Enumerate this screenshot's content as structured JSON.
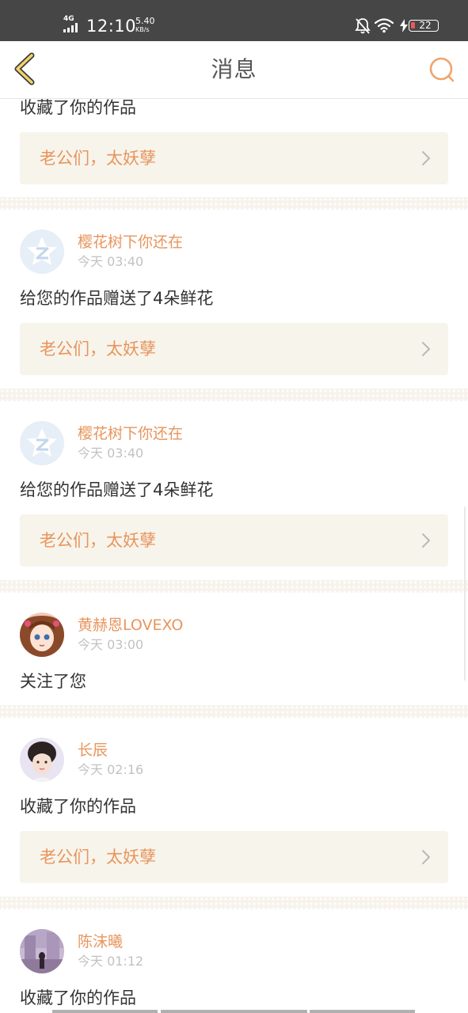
{
  "status_bar": {
    "network": "4G",
    "time": "12:10",
    "speed_value": "5.40",
    "speed_unit": "KB/s",
    "battery": "22",
    "icons": [
      "signal-icon",
      "bell-off-icon",
      "wifi-icon",
      "charging-icon",
      "battery-icon"
    ]
  },
  "header": {
    "title": "消息",
    "back_icon": "chevron-left-icon",
    "search_icon": "search-icon",
    "accent_color": "#e8955c"
  },
  "feed": {
    "partial_item": {
      "action": "收藏了你的作品",
      "work": "老公们，太妖孽"
    },
    "items": [
      {
        "user": "樱花树下你还在",
        "time": "今天 03:40",
        "avatar": "default-avatar",
        "action": "给您的作品赠送了4朵鲜花",
        "work": "老公们，太妖孽"
      },
      {
        "user": "樱花树下你还在",
        "time": "今天 03:40",
        "avatar": "default-avatar",
        "action": "给您的作品赠送了4朵鲜花",
        "work": "老公们，太妖孽"
      },
      {
        "user": "黄赫恩LOVEXO",
        "time": "今天 03:00",
        "avatar": "anime-girl-avatar",
        "action": "关注了您"
      },
      {
        "user": "长辰",
        "time": "今天 02:16",
        "avatar": "girl-portrait-avatar",
        "action": "收藏了你的作品",
        "work": "老公们，太妖孽"
      },
      {
        "user": "陈沫曦",
        "time": "今天 01:12",
        "avatar": "photo-avatar",
        "action": "收藏了你的作品"
      }
    ]
  }
}
